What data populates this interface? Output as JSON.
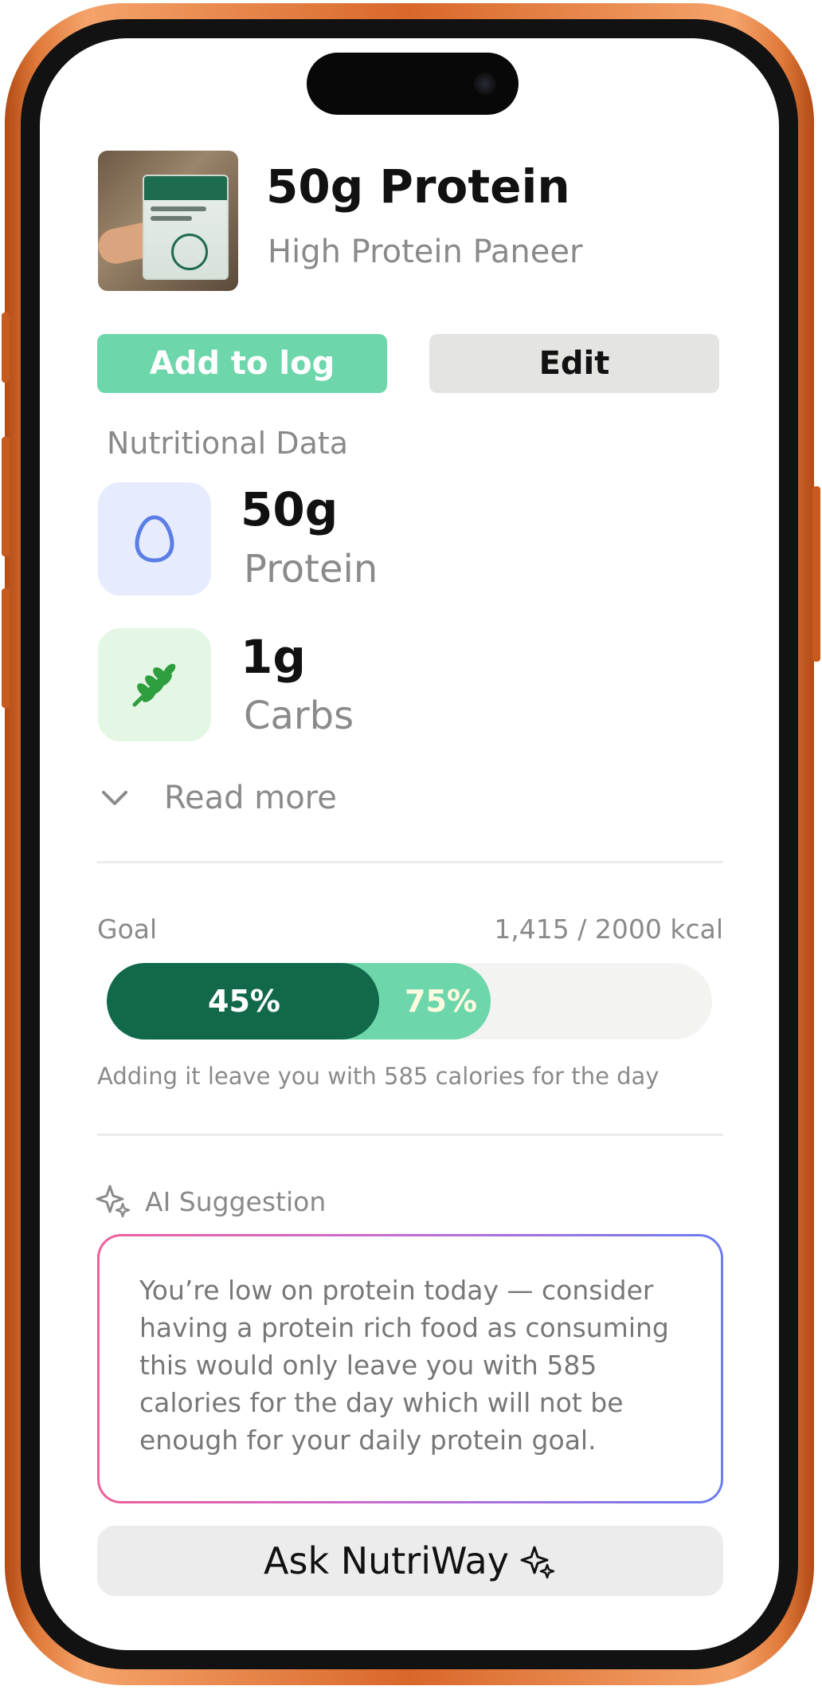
{
  "product": {
    "title": "50g Protein",
    "subtitle": "High Protein Paneer"
  },
  "actions": {
    "add_label": "Add to log",
    "edit_label": "Edit"
  },
  "nutrition": {
    "section_title": "Nutritional Data",
    "items": [
      {
        "value": "50g",
        "name": "Protein",
        "icon": "egg-icon",
        "tile_color": "#e6ecfe",
        "icon_color": "#5b7ee5"
      },
      {
        "value": "1g",
        "name": "Carbs",
        "icon": "wheat-icon",
        "tile_color": "#e4f6e4",
        "icon_color": "#2f9e3f"
      }
    ],
    "read_more_label": "Read more"
  },
  "goal": {
    "label": "Goal",
    "value_text": "1,415 / 2000 kcal",
    "current_percent": 45,
    "projected_percent": 75,
    "current_label": "45%",
    "projected_label": "75%",
    "note": "Adding it leave you with 585 calories for the day"
  },
  "ai": {
    "heading": "AI Suggestion",
    "message": "You’re low on protein today — consider having a protein rich food as consuming this would only leave you with 585 calories for the day which will not be enough for your daily protein goal.",
    "ask_label": "Ask NutriWay"
  },
  "colors": {
    "accent_green": "#6ed6ab",
    "dark_green": "#11694a",
    "frame_orange": "#d9672a"
  }
}
